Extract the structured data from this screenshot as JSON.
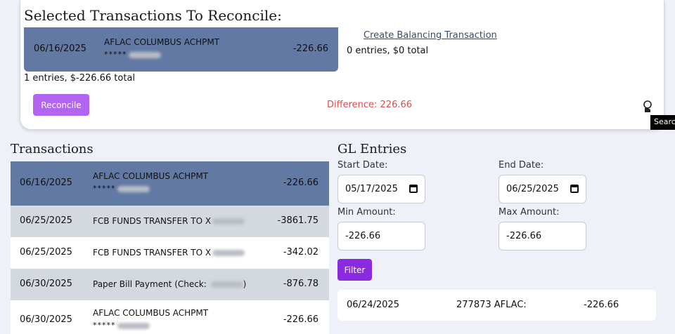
{
  "selected_panel": {
    "title": "Selected Transactions To Reconcile:",
    "selected_entry": {
      "date": "06/16/2025",
      "description": "AFLAC COLUMBUS ACHPMT",
      "account": "*****",
      "amount": "-226.66"
    },
    "summary": "1 entries, $-226.66 total",
    "create_balancing_label": "Create Balancing Transaction",
    "balancing_summary": "0 entries, $0 total",
    "reconcile_label": "Reconcile",
    "difference": "Difference: 226.66",
    "search_tooltip": "Search"
  },
  "transactions": {
    "title": "Transactions",
    "rows": [
      {
        "date": "06/16/2025",
        "description": "AFLAC COLUMBUS ACHPMT",
        "account": "*****",
        "amount": "-226.66",
        "style": "selected"
      },
      {
        "date": "06/25/2025",
        "description": "FCB FUNDS TRANSFER TO X",
        "account": "",
        "amount": "-3861.75",
        "style": "gray"
      },
      {
        "date": "06/25/2025",
        "description": "FCB FUNDS TRANSFER TO X",
        "account": "",
        "amount": "-342.02",
        "style": "white"
      },
      {
        "date": "06/30/2025",
        "description": "Paper Bill Payment (Check: ",
        "account": "",
        "amount": "-876.78",
        "style": "gray"
      },
      {
        "date": "06/30/2025",
        "description": "AFLAC COLUMBUS ACHPMT",
        "account": "*****",
        "amount": "-226.66",
        "style": "white"
      }
    ]
  },
  "gl_entries": {
    "title": "GL Entries",
    "start_date_label": "Start Date:",
    "start_date": "05/17/2025",
    "end_date_label": "End Date:",
    "end_date": "06/25/2025",
    "min_amount_label": "Min Amount:",
    "min_amount": "-226.66",
    "max_amount_label": "Max Amount:",
    "max_amount": "-226.66",
    "filter_label": "Filter",
    "rows": [
      {
        "date": "06/24/2025",
        "description": "277873 AFLAC:",
        "amount": "-226.66"
      }
    ]
  },
  "colors": {
    "selected_row": "#6279a3",
    "gray_row": "#d4d8df",
    "reconcile_button": "#b266f0",
    "filter_button": "#8a2be2",
    "difference_text": "#e04a4a"
  }
}
